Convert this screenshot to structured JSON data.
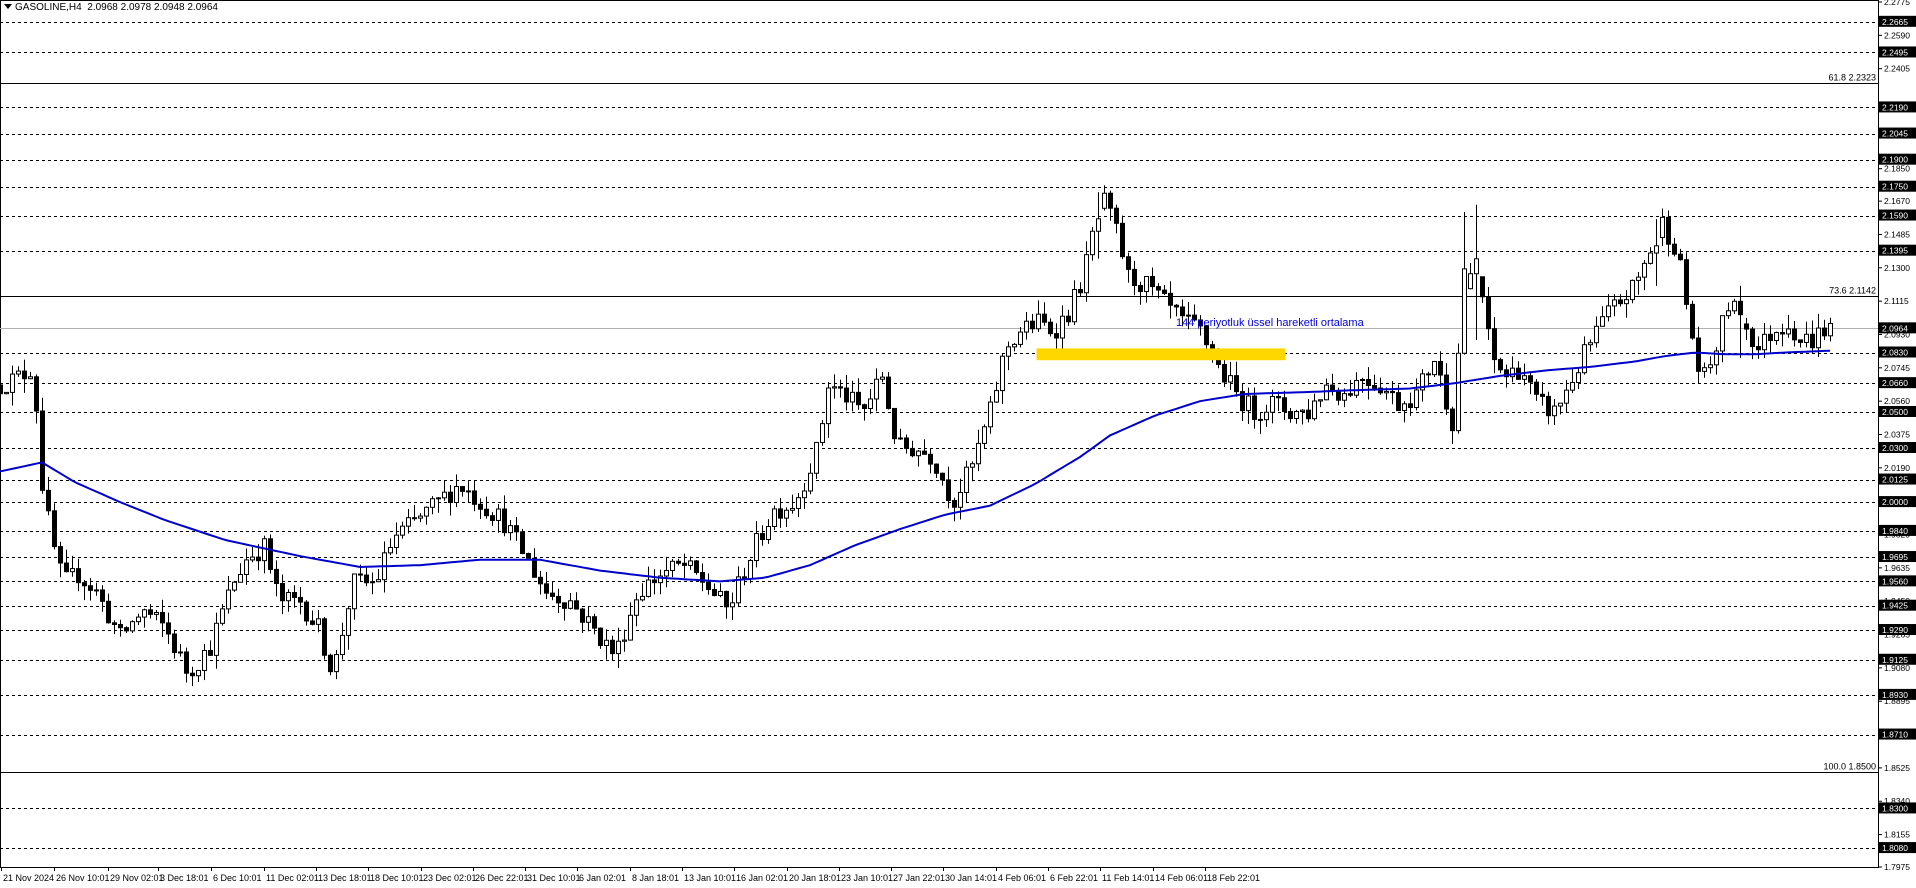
{
  "header": {
    "symbol": "GASOLINE,H4",
    "ohlc": "2.0968 2.0978 2.0948 2.0964"
  },
  "chart_data": {
    "type": "candlestick",
    "symbol": "GASOLINE",
    "timeframe": "H4",
    "ylim": [
      1.7975,
      2.2775
    ],
    "current_price": "2.0964",
    "y_ticks": [
      "2.2775",
      "2.2590",
      "2.2405",
      "2.2045",
      "2.1850",
      "2.1670",
      "2.1485",
      "2.1300",
      "2.1115",
      "2.0930",
      "2.0745",
      "2.0560",
      "2.0375",
      "2.0190",
      "2.0005",
      "1.9820",
      "1.9635",
      "1.9450",
      "1.9265",
      "1.9080",
      "1.8895",
      "1.8710",
      "1.8525",
      "1.8340",
      "1.8155",
      "1.7975"
    ],
    "levels": [
      {
        "value": 2.2665,
        "label": "2.2665"
      },
      {
        "value": 2.2495,
        "label": "2.2495"
      },
      {
        "value": 2.219,
        "label": "2.2190"
      },
      {
        "value": 2.2045,
        "label": "2.2045"
      },
      {
        "value": 2.19,
        "label": "2.1900"
      },
      {
        "value": 2.175,
        "label": "2.1750"
      },
      {
        "value": 2.159,
        "label": "2.1590"
      },
      {
        "value": 2.1395,
        "label": "2.1395"
      },
      {
        "value": 2.083,
        "label": "2.0830"
      },
      {
        "value": 2.066,
        "label": "2.0660"
      },
      {
        "value": 2.05,
        "label": "2.0500"
      },
      {
        "value": 2.03,
        "label": "2.0300"
      },
      {
        "value": 2.0125,
        "label": "2.0125"
      },
      {
        "value": 2.0,
        "label": "2.0000"
      },
      {
        "value": 1.984,
        "label": "1.9840"
      },
      {
        "value": 1.9695,
        "label": "1.9695"
      },
      {
        "value": 1.956,
        "label": "1.9560"
      },
      {
        "value": 1.9425,
        "label": "1.9425"
      },
      {
        "value": 1.929,
        "label": "1.9290"
      },
      {
        "value": 1.9125,
        "label": "1.9125"
      },
      {
        "value": 1.893,
        "label": "1.8930"
      },
      {
        "value": 1.871,
        "label": "1.8710"
      },
      {
        "value": 1.83,
        "label": "1.8300"
      },
      {
        "value": 1.808,
        "label": "1.8080"
      }
    ],
    "fib_levels": [
      {
        "value": 2.2323,
        "label": "61.8 2.2323"
      },
      {
        "value": 2.1142,
        "label": "73.6 2.1142"
      },
      {
        "value": 1.85,
        "label": "100.0 1.8500"
      }
    ],
    "zone": {
      "from": 2.079,
      "to": 2.085,
      "color": "#ffd700"
    },
    "ema_label": "144 periyotluk üssel hareketli ortalama",
    "colors": {
      "ema": "#0000cc",
      "candle": "#000000",
      "zone": "#ffd700",
      "ema_text": "#0000dd",
      "badge": "#000000"
    },
    "x_labels": [
      "21 Nov 2024",
      "26 Nov 10:01",
      "29 Nov 02:01",
      "3 Dec 18:01",
      "6 Dec 10:01",
      "11 Dec 02:01",
      "13 Dec 18:01",
      "18 Dec 10:01",
      "23 Dec 02:01",
      "26 Dec 22:01",
      "31 Dec 10:01",
      "6 Jan 02:01",
      "8 Jan 18:01",
      "13 Jan 10:01",
      "16 Jan 02:01",
      "20 Jan 18:01",
      "23 Jan 10:01",
      "27 Jan 22:01",
      "30 Jan 14:01",
      "4 Feb 06:01",
      "6 Feb 22:01",
      "11 Feb 14:01",
      "14 Feb 06:01",
      "18 Feb 22:01"
    ],
    "price_path": [
      [
        0,
        2.065
      ],
      [
        14,
        2.07
      ],
      [
        22,
        2.075
      ],
      [
        28,
        2.01
      ],
      [
        34,
        1.98
      ],
      [
        42,
        1.955
      ],
      [
        52,
        1.96
      ],
      [
        64,
        1.95
      ],
      [
        80,
        1.925
      ],
      [
        95,
        1.94
      ],
      [
        110,
        1.93
      ],
      [
        125,
        1.905
      ],
      [
        140,
        1.92
      ],
      [
        155,
        1.955
      ],
      [
        165,
        1.97
      ],
      [
        176,
        1.975
      ],
      [
        186,
        1.945
      ],
      [
        200,
        1.945
      ],
      [
        212,
        1.93
      ],
      [
        222,
        1.905
      ],
      [
        235,
        1.955
      ],
      [
        250,
        1.955
      ],
      [
        262,
        1.98
      ],
      [
        278,
        1.99
      ],
      [
        292,
        2.0
      ],
      [
        306,
        2.01
      ],
      [
        320,
        2.0
      ],
      [
        335,
        1.99
      ],
      [
        350,
        1.97
      ],
      [
        364,
        1.95
      ],
      [
        380,
        1.945
      ],
      [
        395,
        1.93
      ],
      [
        410,
        1.915
      ],
      [
        425,
        1.95
      ],
      [
        440,
        1.96
      ],
      [
        455,
        1.965
      ],
      [
        470,
        1.955
      ],
      [
        485,
        1.94
      ],
      [
        500,
        1.97
      ],
      [
        515,
        1.995
      ],
      [
        530,
        2.0
      ],
      [
        545,
        2.03
      ],
      [
        552,
        2.065
      ],
      [
        562,
        2.06
      ],
      [
        575,
        2.05
      ],
      [
        588,
        2.07
      ],
      [
        598,
        2.03
      ],
      [
        610,
        2.03
      ],
      [
        622,
        2.025
      ],
      [
        635,
        2.0
      ],
      [
        648,
        2.02
      ],
      [
        660,
        2.05
      ],
      [
        670,
        2.085
      ],
      [
        680,
        2.095
      ],
      [
        692,
        2.1
      ],
      [
        702,
        2.095
      ],
      [
        712,
        2.105
      ],
      [
        722,
        2.125
      ],
      [
        734,
        2.17
      ],
      [
        744,
        2.15
      ],
      [
        752,
        2.125
      ],
      [
        764,
        2.12
      ],
      [
        776,
        2.11
      ],
      [
        788,
        2.1
      ],
      [
        800,
        2.095
      ],
      [
        812,
        2.075
      ],
      [
        824,
        2.06
      ],
      [
        836,
        2.05
      ],
      [
        848,
        2.055
      ],
      [
        860,
        2.05
      ],
      [
        872,
        2.05
      ],
      [
        884,
        2.065
      ],
      [
        896,
        2.06
      ],
      [
        908,
        2.07
      ],
      [
        920,
        2.065
      ],
      [
        932,
        2.055
      ],
      [
        944,
        2.06
      ],
      [
        956,
        2.08
      ],
      [
        968,
        2.045
      ],
      [
        976,
        2.12
      ],
      [
        986,
        2.125
      ],
      [
        994,
        2.08
      ],
      [
        1004,
        2.07
      ],
      [
        1014,
        2.075
      ],
      [
        1024,
        2.055
      ],
      [
        1036,
        2.05
      ],
      [
        1046,
        2.065
      ],
      [
        1058,
        2.085
      ],
      [
        1068,
        2.1
      ],
      [
        1078,
        2.11
      ],
      [
        1090,
        2.12
      ],
      [
        1100,
        2.14
      ],
      [
        1108,
        2.155
      ],
      [
        1118,
        2.14
      ],
      [
        1126,
        2.1
      ],
      [
        1134,
        2.065
      ],
      [
        1142,
        2.08
      ],
      [
        1152,
        2.11
      ],
      [
        1162,
        2.1
      ],
      [
        1172,
        2.085
      ],
      [
        1182,
        2.095
      ],
      [
        1192,
        2.1
      ],
      [
        1200,
        2.09
      ],
      [
        1208,
        2.09
      ],
      [
        1214,
        2.095
      ],
      [
        1220,
        2.0964
      ]
    ],
    "ema_path": [
      [
        0,
        2.017
      ],
      [
        28,
        2.022
      ],
      [
        50,
        2.011
      ],
      [
        80,
        2.0
      ],
      [
        110,
        1.99
      ],
      [
        150,
        1.979
      ],
      [
        200,
        1.97
      ],
      [
        240,
        1.964
      ],
      [
        280,
        1.965
      ],
      [
        320,
        1.968
      ],
      [
        360,
        1.968
      ],
      [
        400,
        1.962
      ],
      [
        440,
        1.958
      ],
      [
        480,
        1.956
      ],
      [
        510,
        1.958
      ],
      [
        540,
        1.965
      ],
      [
        570,
        1.976
      ],
      [
        600,
        1.985
      ],
      [
        630,
        1.993
      ],
      [
        660,
        1.998
      ],
      [
        690,
        2.01
      ],
      [
        720,
        2.025
      ],
      [
        740,
        2.037
      ],
      [
        770,
        2.048
      ],
      [
        800,
        2.056
      ],
      [
        830,
        2.06
      ],
      [
        870,
        2.061
      ],
      [
        900,
        2.062
      ],
      [
        940,
        2.063
      ],
      [
        970,
        2.066
      ],
      [
        1000,
        2.07
      ],
      [
        1030,
        2.073
      ],
      [
        1060,
        2.075
      ],
      [
        1090,
        2.078
      ],
      [
        1110,
        2.081
      ],
      [
        1130,
        2.083
      ],
      [
        1150,
        2.082
      ],
      [
        1170,
        2.082
      ],
      [
        1190,
        2.083
      ],
      [
        1220,
        2.084
      ]
    ],
    "spikes": [
      [
        975,
        2.082,
        2.161
      ],
      [
        986,
        2.09,
        2.165
      ],
      [
        1106,
        2.12,
        2.157
      ],
      [
        734,
        2.135,
        2.172
      ],
      [
        1160,
        2.08,
        2.12
      ]
    ]
  }
}
